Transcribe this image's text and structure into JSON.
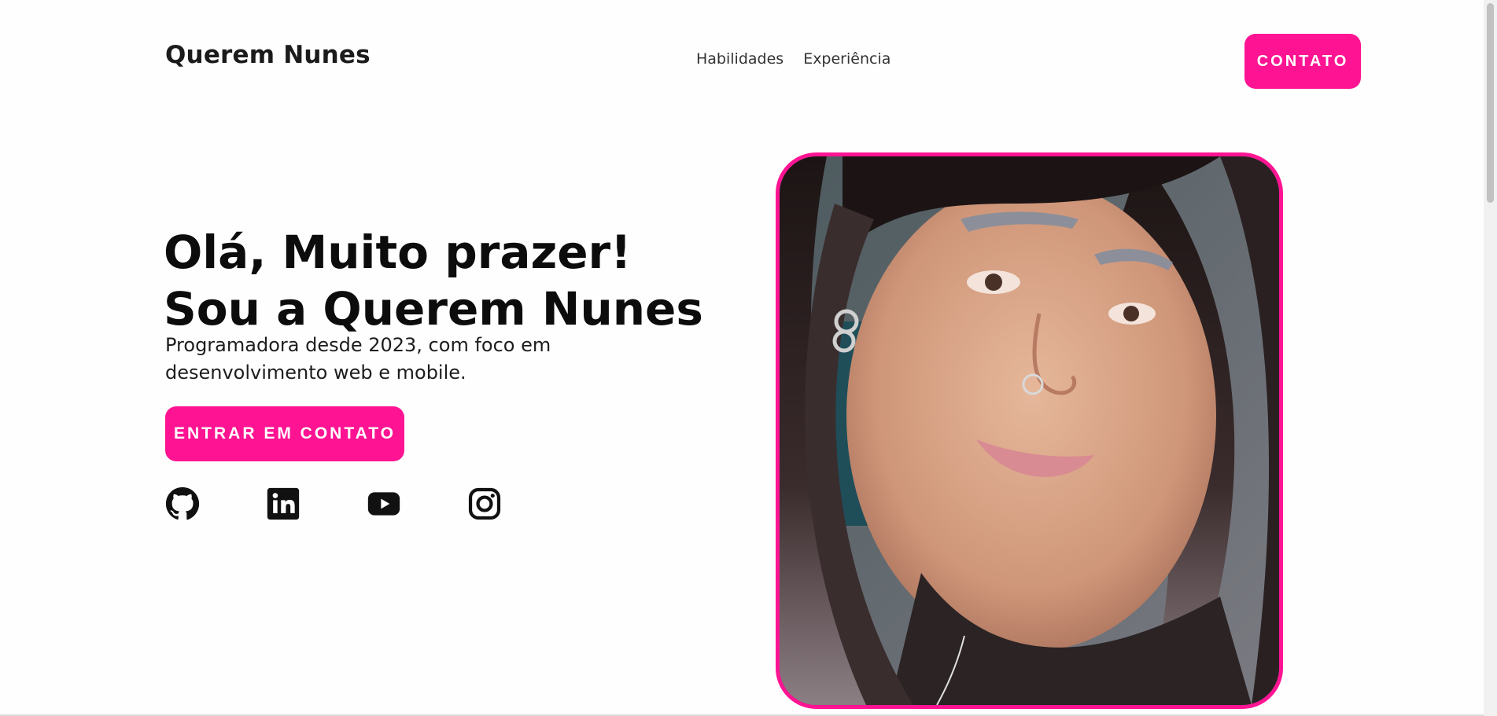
{
  "header": {
    "brand": "Querem Nunes",
    "nav": [
      {
        "label": "Habilidades"
      },
      {
        "label": "Experiência"
      }
    ],
    "contact_label": "CONTATO"
  },
  "hero": {
    "title_line1": "Olá, Muito prazer!",
    "title_line2": "Sou a Querem Nunes",
    "subtitle": "Programadora desde 2023, com foco em desenvolvimento web e mobile.",
    "cta_label": "ENTRAR EM CONTATO",
    "socials": [
      {
        "icon": "github-icon"
      },
      {
        "icon": "linkedin-icon"
      },
      {
        "icon": "youtube-icon"
      },
      {
        "icon": "instagram-icon"
      }
    ]
  },
  "colors": {
    "accent": "#fe1493",
    "text": "#0c0c0c",
    "background": "#fefefe"
  }
}
